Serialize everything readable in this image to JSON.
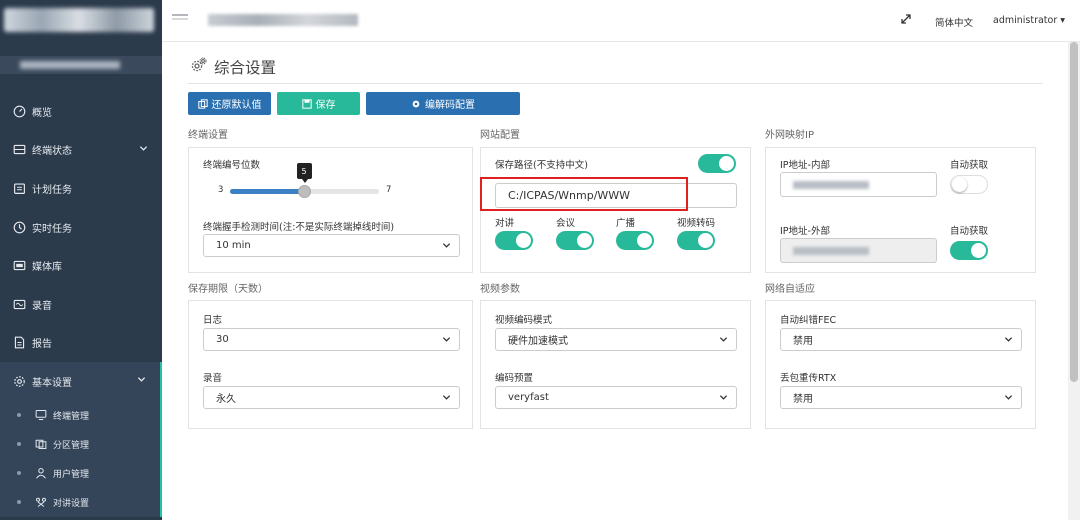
{
  "sidebar": {
    "items": [
      {
        "label": "概览",
        "icon": "gauge-icon"
      },
      {
        "label": "终端状态",
        "icon": "terminal-icon"
      },
      {
        "label": "计划任务",
        "icon": "calendar-icon"
      },
      {
        "label": "实时任务",
        "icon": "clock-icon"
      },
      {
        "label": "媒体库",
        "icon": "media-icon"
      },
      {
        "label": "录音",
        "icon": "recording-icon"
      },
      {
        "label": "报告",
        "icon": "report-icon"
      },
      {
        "label": "基本设置",
        "icon": "gear-icon"
      }
    ],
    "subitems": [
      {
        "label": "终端管理",
        "icon": "monitor-icon"
      },
      {
        "label": "分区管理",
        "icon": "partition-icon"
      },
      {
        "label": "用户管理",
        "icon": "user-icon"
      },
      {
        "label": "对讲设置",
        "icon": "intercom-icon"
      }
    ]
  },
  "topbar": {
    "language": "简体中文",
    "user": "administrator"
  },
  "page": {
    "title": "综合设置"
  },
  "toolbar": {
    "reset_label": "还原默认值",
    "save_label": "保存",
    "codec_label": "编解码配置"
  },
  "sections": {
    "terminal": {
      "title": "终端设置",
      "digits_label": "终端编号位数",
      "slider_min": "3",
      "slider_max": "7",
      "slider_value": "5",
      "slider_value_num": 5,
      "heartbeat_label": "终端握手检测时间(注:不是实际终端掉线时间)",
      "heartbeat_value": "10 min"
    },
    "website": {
      "title": "网站配置",
      "path_label": "保存路径(不支持中文)",
      "path_value": "C:/ICPAS/Wnmp/WWW",
      "path_enabled": true,
      "features": [
        {
          "label": "对讲",
          "on": true
        },
        {
          "label": "会议",
          "on": true
        },
        {
          "label": "广播",
          "on": true
        },
        {
          "label": "视频转码",
          "on": true
        }
      ]
    },
    "external_ip": {
      "title": "外网映射IP",
      "internal_label": "IP地址-内部",
      "internal_auto_label": "自动获取",
      "internal_auto": false,
      "external_label": "IP地址-外部",
      "external_auto_label": "自动获取",
      "external_auto": true
    },
    "retention": {
      "title": "保存期限（天数）",
      "log_label": "日志",
      "log_value": "30",
      "recording_label": "录音",
      "recording_value": "永久"
    },
    "video": {
      "title": "视频参数",
      "encode_mode_label": "视频编码模式",
      "encode_mode_value": "硬件加速模式",
      "preset_label": "编码预置",
      "preset_value": "veryfast"
    },
    "network": {
      "title": "网络自适应",
      "fec_label": "自动纠错FEC",
      "fec_value": "禁用",
      "rtx_label": "丢包重传RTX",
      "rtx_value": "禁用"
    }
  },
  "colors": {
    "sidebar_bg": "#2c3b4c",
    "primary": "#2a6fb0",
    "success": "#27b99a",
    "highlight": "#e01f1f"
  }
}
